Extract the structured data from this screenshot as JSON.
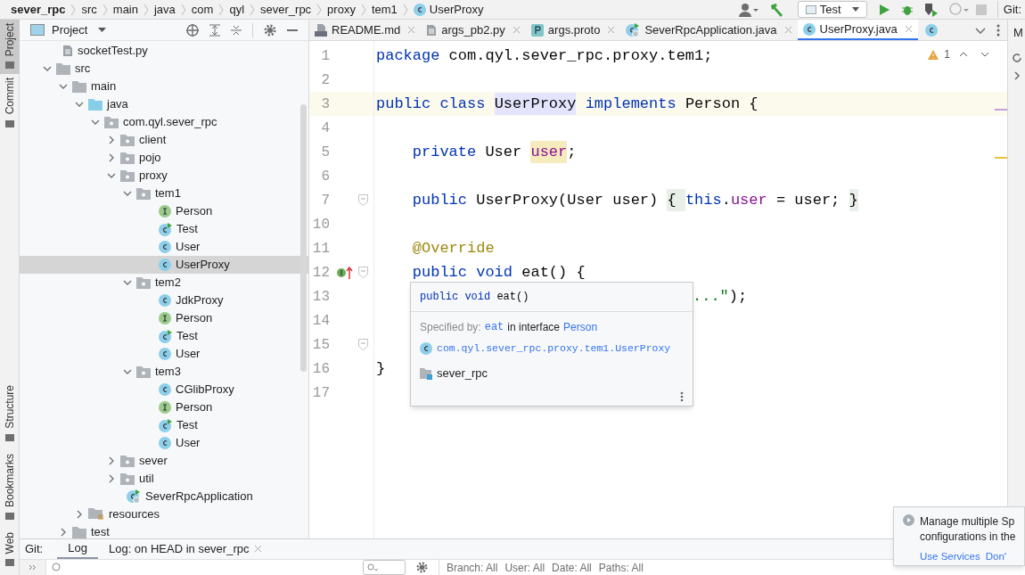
{
  "breadcrumbs": [
    {
      "label": "sever_rpc",
      "kind": "project"
    },
    {
      "label": "src",
      "kind": "folder"
    },
    {
      "label": "main",
      "kind": "folder"
    },
    {
      "label": "java",
      "kind": "folder"
    },
    {
      "label": "com",
      "kind": "folder"
    },
    {
      "label": "qyl",
      "kind": "folder"
    },
    {
      "label": "sever_rpc",
      "kind": "folder"
    },
    {
      "label": "proxy",
      "kind": "folder"
    },
    {
      "label": "tem1",
      "kind": "folder"
    },
    {
      "label": "UserProxy",
      "kind": "class"
    }
  ],
  "toolbar": {
    "run_config": "Test",
    "git_label": "Git:"
  },
  "left_stripe": [
    {
      "label": "Project",
      "selected": true,
      "kind": "top"
    },
    {
      "label": "Commit",
      "selected": false,
      "kind": "top"
    },
    {
      "label": "Structure",
      "selected": false,
      "kind": "bottom"
    },
    {
      "label": "Bookmarks",
      "selected": false,
      "kind": "bottom"
    },
    {
      "label": "Web",
      "selected": false,
      "kind": "bottom"
    }
  ],
  "project_panel": {
    "title": "Project"
  },
  "tree": [
    {
      "name": "socketTest.py",
      "kind": "file",
      "selected": false
    },
    {
      "name": "src",
      "kind": "folder",
      "expanded": true,
      "selected": false,
      "children": [
        {
          "name": "main",
          "kind": "folder",
          "expanded": true,
          "selected": false,
          "children": [
            {
              "name": "java",
              "kind": "source",
              "expanded": true,
              "selected": false,
              "children": [
                {
                  "name": "com.qyl.sever_rpc",
                  "kind": "package",
                  "expanded": true,
                  "selected": false,
                  "children": [
                    {
                      "name": "client",
                      "kind": "package",
                      "expanded": false,
                      "selected": false
                    },
                    {
                      "name": "pojo",
                      "kind": "package",
                      "expanded": false,
                      "selected": false
                    },
                    {
                      "name": "proxy",
                      "kind": "package",
                      "expanded": true,
                      "selected": false,
                      "children": [
                        {
                          "name": "tem1",
                          "kind": "package",
                          "expanded": true,
                          "selected": false,
                          "children": [
                            {
                              "name": "Person",
                              "kind": "interface",
                              "selected": false
                            },
                            {
                              "name": "Test",
                              "kind": "runnable",
                              "selected": false
                            },
                            {
                              "name": "User",
                              "kind": "class",
                              "selected": false
                            },
                            {
                              "name": "UserProxy",
                              "kind": "class",
                              "selected": true
                            }
                          ]
                        },
                        {
                          "name": "tem2",
                          "kind": "package",
                          "expanded": true,
                          "selected": false,
                          "children": [
                            {
                              "name": "JdkProxy",
                              "kind": "class",
                              "selected": false
                            },
                            {
                              "name": "Person",
                              "kind": "interface",
                              "selected": false
                            },
                            {
                              "name": "Test",
                              "kind": "runnable",
                              "selected": false
                            },
                            {
                              "name": "User",
                              "kind": "class",
                              "selected": false
                            }
                          ]
                        },
                        {
                          "name": "tem3",
                          "kind": "package",
                          "expanded": true,
                          "selected": false,
                          "children": [
                            {
                              "name": "CGlibProxy",
                              "kind": "class",
                              "selected": false
                            },
                            {
                              "name": "Person",
                              "kind": "interface",
                              "selected": false
                            },
                            {
                              "name": "Test",
                              "kind": "runnable",
                              "selected": false
                            },
                            {
                              "name": "User",
                              "kind": "class",
                              "selected": false
                            }
                          ]
                        }
                      ]
                    },
                    {
                      "name": "sever",
                      "kind": "package",
                      "expanded": false,
                      "selected": false
                    },
                    {
                      "name": "util",
                      "kind": "package",
                      "expanded": false,
                      "selected": false
                    },
                    {
                      "name": "SeverRpcApplication",
                      "kind": "app",
                      "selected": false
                    }
                  ]
                }
              ]
            },
            {
              "name": "resources",
              "kind": "resources",
              "expanded": false,
              "selected": false
            }
          ]
        },
        {
          "name": "test",
          "kind": "folder",
          "expanded": false,
          "selected": false
        }
      ]
    }
  ],
  "editor_tabs": [
    {
      "label": "README.md",
      "kind": "md",
      "selected": false
    },
    {
      "label": "args_pb2.py",
      "kind": "file",
      "selected": false
    },
    {
      "label": "args.proto",
      "kind": "proto",
      "selected": false
    },
    {
      "label": "SeverRpcApplication.java",
      "kind": "app",
      "selected": false
    },
    {
      "label": "UserProxy.java",
      "kind": "class",
      "selected": true
    }
  ],
  "right_stripe": {
    "label": "M"
  },
  "inspection": {
    "count": "1"
  },
  "code": [
    {
      "number": "1",
      "tokens": [
        {
          "text": "package",
          "kind": "keyword"
        },
        {
          "text": " com.qyl.sever_rpc.proxy.tem1;",
          "kind": "plain"
        }
      ]
    },
    {
      "number": "2"
    },
    {
      "number": "3",
      "current": true,
      "tokens": [
        {
          "text": "public class ",
          "kind": "keyword"
        },
        {
          "text": "UserProxy",
          "kind": "match"
        },
        {
          "text": " implements ",
          "kind": "keyword"
        },
        {
          "text": "Person {",
          "kind": "plain"
        }
      ]
    },
    {
      "number": "4"
    },
    {
      "number": "5",
      "tokens": [
        {
          "text": "    private ",
          "kind": "keyword"
        },
        {
          "text": "User ",
          "kind": "plain"
        },
        {
          "text": "user",
          "kind": "field_marked"
        },
        {
          "text": ";",
          "kind": "plain"
        }
      ]
    },
    {
      "number": "6"
    },
    {
      "number": "7",
      "fold": true,
      "tokens": [
        {
          "text": "    public ",
          "kind": "keyword"
        },
        {
          "text": "UserProxy(User user) ",
          "kind": "plain"
        },
        {
          "text": "{ ",
          "kind": "fold"
        },
        {
          "text": "this",
          "kind": "keyword"
        },
        {
          "text": ".",
          "kind": "plain"
        },
        {
          "text": "user",
          "kind": "field"
        },
        {
          "text": " = user; ",
          "kind": "plain"
        },
        {
          "text": "}",
          "kind": "fold"
        }
      ]
    },
    {
      "number": "10"
    },
    {
      "number": "11",
      "tokens": [
        {
          "text": "    @Override",
          "kind": "annotation"
        }
      ]
    },
    {
      "number": "12",
      "implements": true,
      "fold": true,
      "tokens": [
        {
          "text": "    public void ",
          "kind": "keyword"
        },
        {
          "text": "eat() {",
          "kind": "plain"
        }
      ]
    },
    {
      "number": "13",
      "covered": true,
      "tokens": [
        {
          "text": "...\"",
          "kind": "string"
        },
        {
          "text": ");",
          "kind": "plain"
        }
      ]
    },
    {
      "number": "14"
    },
    {
      "number": "15",
      "fold": true
    },
    {
      "number": "16",
      "tokens": [
        {
          "text": "}",
          "kind": "plain"
        }
      ]
    },
    {
      "number": "17"
    }
  ],
  "doc_popup": {
    "signature_tokens": [
      {
        "text": "public void ",
        "kind": "keyword"
      },
      {
        "text": "eat()",
        "kind": "plain"
      }
    ],
    "specified_label": "Specified by:",
    "method": "eat",
    "in_text": "in interface",
    "interface": "Person",
    "class_path": "com.qyl.sever_rpc.proxy.tem1.UserProxy",
    "module": "sever_rpc"
  },
  "bottom_panel": {
    "title": "Git:",
    "tabs": [
      {
        "label": "Log",
        "selected": true,
        "closable": false
      },
      {
        "label": "Log: on HEAD in sever_rpc",
        "selected": false,
        "closable": true
      }
    ],
    "filters": [
      {
        "label": "Branch: All"
      },
      {
        "label": "User: All"
      },
      {
        "label": "Date: All"
      },
      {
        "label": "Paths: All"
      }
    ]
  },
  "notification": {
    "message_lines": [
      "Manage multiple Sp",
      "configurations in the"
    ],
    "links": [
      "Use Services",
      "Don'"
    ]
  }
}
